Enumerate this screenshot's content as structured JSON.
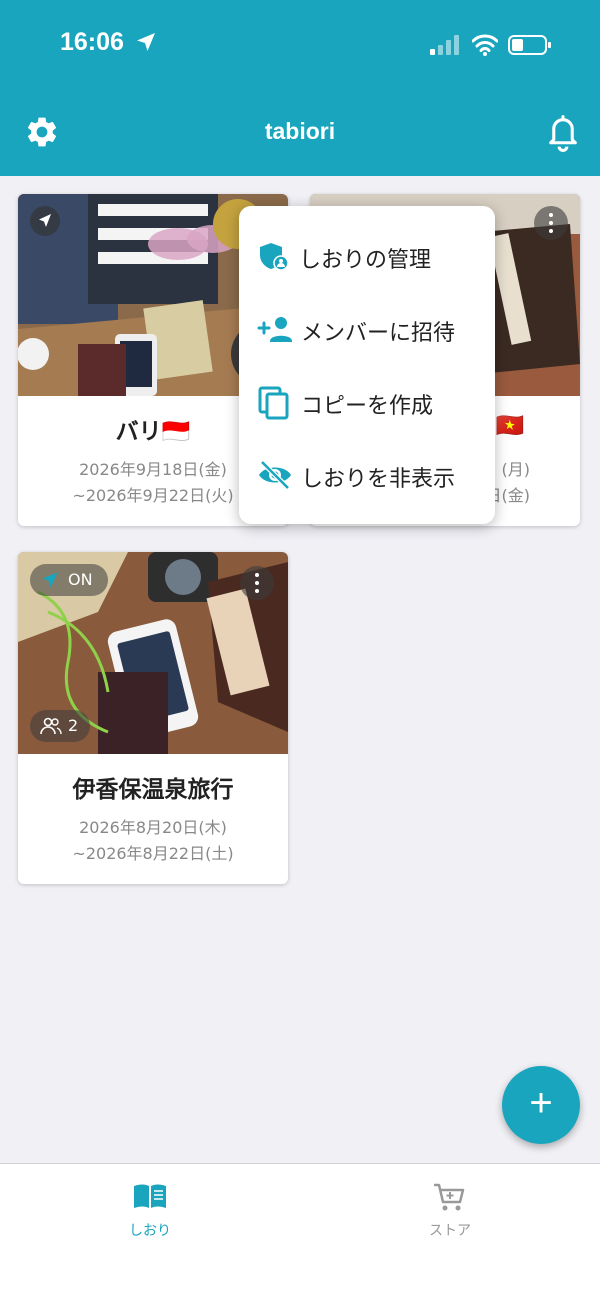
{
  "status_bar": {
    "time": "16:06"
  },
  "header": {
    "title": "tabiori"
  },
  "cards": [
    {
      "title": "バリ🇮🇩",
      "date_start": "2026年9月18日(金)",
      "date_end": "~2026年9月22日(火)"
    },
    {
      "title": "🇻🇳",
      "date_start": "(月)",
      "date_end": "日(金)"
    },
    {
      "title": "伊香保温泉旅行",
      "date_start": "2026年8月20日(木)",
      "date_end": "~2026年8月22日(土)",
      "tracking_label": "ON",
      "member_count": "2"
    }
  ],
  "menu": {
    "items": [
      {
        "label": "しおりの管理",
        "icon": "shield-person-icon"
      },
      {
        "label": "メンバーに招待",
        "icon": "add-person-icon"
      },
      {
        "label": "コピーを作成",
        "icon": "copy-icon"
      },
      {
        "label": "しおりを非表示",
        "icon": "eye-off-icon"
      }
    ]
  },
  "fab": {
    "label": "+"
  },
  "tabbar": {
    "tabs": [
      {
        "label": "しおり",
        "icon": "book-icon",
        "active": true
      },
      {
        "label": "ストア",
        "icon": "cart-icon",
        "active": false
      }
    ]
  },
  "colors": {
    "primary": "#1aa5be",
    "background": "#f0f0f5",
    "inactive": "#999999"
  }
}
